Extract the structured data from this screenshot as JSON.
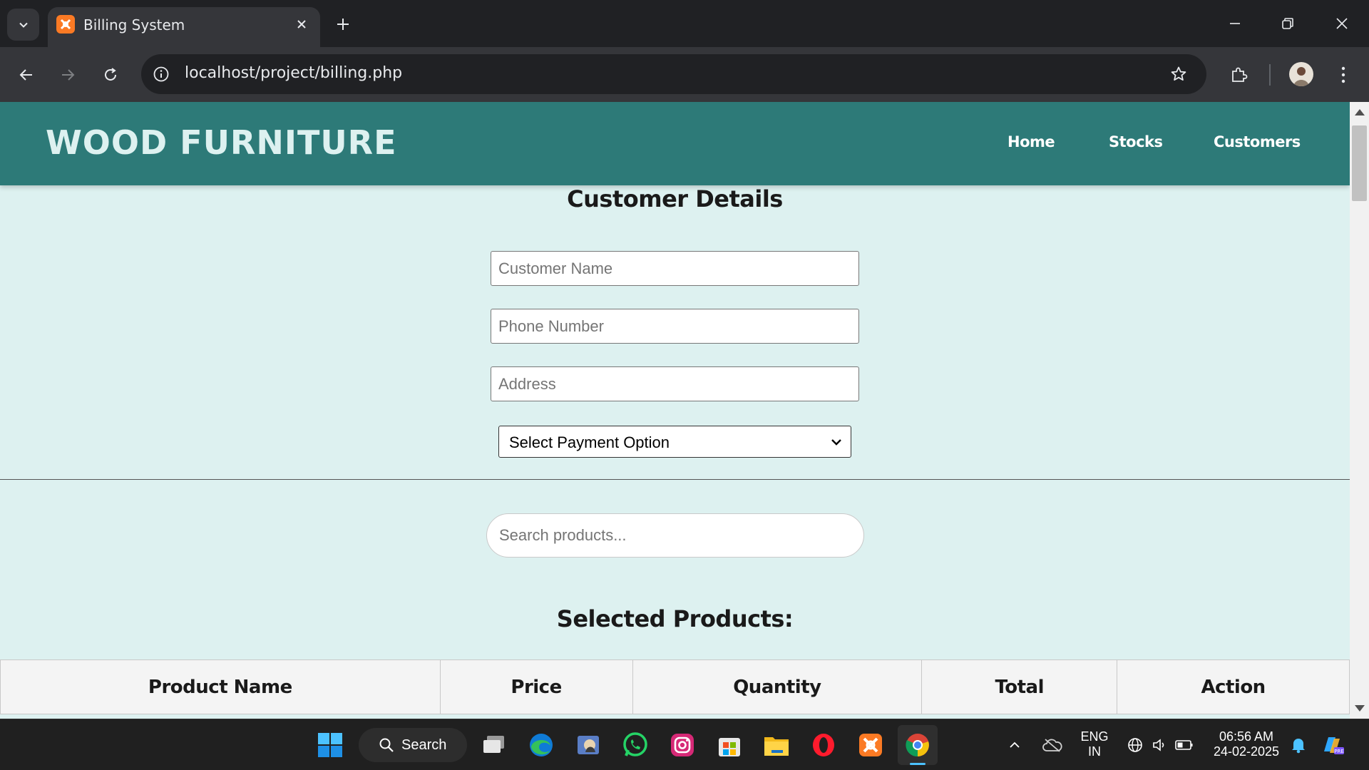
{
  "browser": {
    "tab_title": "Billing System",
    "url": "localhost/project/billing.php"
  },
  "site": {
    "brand": "WOOD FURNITURE",
    "nav": [
      "Home",
      "Stocks",
      "Customers"
    ]
  },
  "customer_form": {
    "title": "Customer Details",
    "name_placeholder": "Customer Name",
    "phone_placeholder": "Phone Number",
    "address_placeholder": "Address",
    "payment_selected": "Select Payment Option"
  },
  "product_search": {
    "placeholder": "Search products..."
  },
  "selected_products": {
    "title": "Selected Products:",
    "columns": [
      "Product Name",
      "Price",
      "Quantity",
      "Total",
      "Action"
    ]
  },
  "taskbar": {
    "search_label": "Search",
    "lang_line1": "ENG",
    "lang_line2": "IN",
    "time": "06:56 AM",
    "date": "24-02-2025"
  },
  "colors": {
    "header_teal": "#2d7a78",
    "page_bg": "#ddf1f0",
    "brand_text": "#ddf1f0"
  }
}
